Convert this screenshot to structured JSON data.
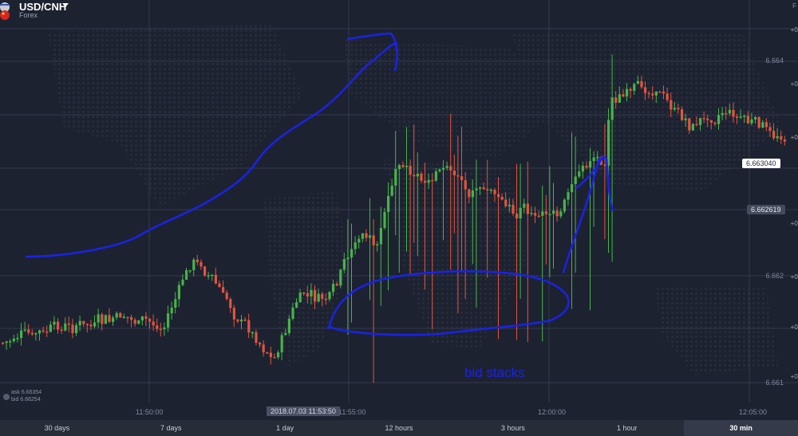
{
  "header": {
    "symbol": "USD/CNH",
    "market": "Forex",
    "top_right": "F"
  },
  "y_axis": {
    "labels": [
      "6.664",
      "6.662",
      "6.661"
    ],
    "edge_labels": [
      "+0.",
      "+0.",
      "+0.",
      "+0.",
      "+0.",
      "+0.",
      "+0."
    ]
  },
  "x_axis": {
    "labels": [
      "11:50:00",
      "11:55:00",
      "12:00:00",
      "12:05:00"
    ]
  },
  "current_time": "2018.07.03 11:53:50",
  "price_badges": {
    "upper": "6.663040",
    "lower": "6.662619"
  },
  "ask_bid": {
    "ask": "ask 6.66354",
    "bid": "bid 6.66254"
  },
  "annotation": "bid stacks",
  "timeframes": [
    {
      "label": "30 days",
      "active": false
    },
    {
      "label": "7 days",
      "active": false
    },
    {
      "label": "1 day",
      "active": false
    },
    {
      "label": "12 hours",
      "active": false
    },
    {
      "label": "3 hours",
      "active": false
    },
    {
      "label": "1 hour",
      "active": false
    },
    {
      "label": "30 min",
      "active": true
    }
  ],
  "colors": {
    "up": "#47b34a",
    "down": "#e0553f",
    "annotation": "#1a22e8",
    "background": "#1d2230"
  }
}
